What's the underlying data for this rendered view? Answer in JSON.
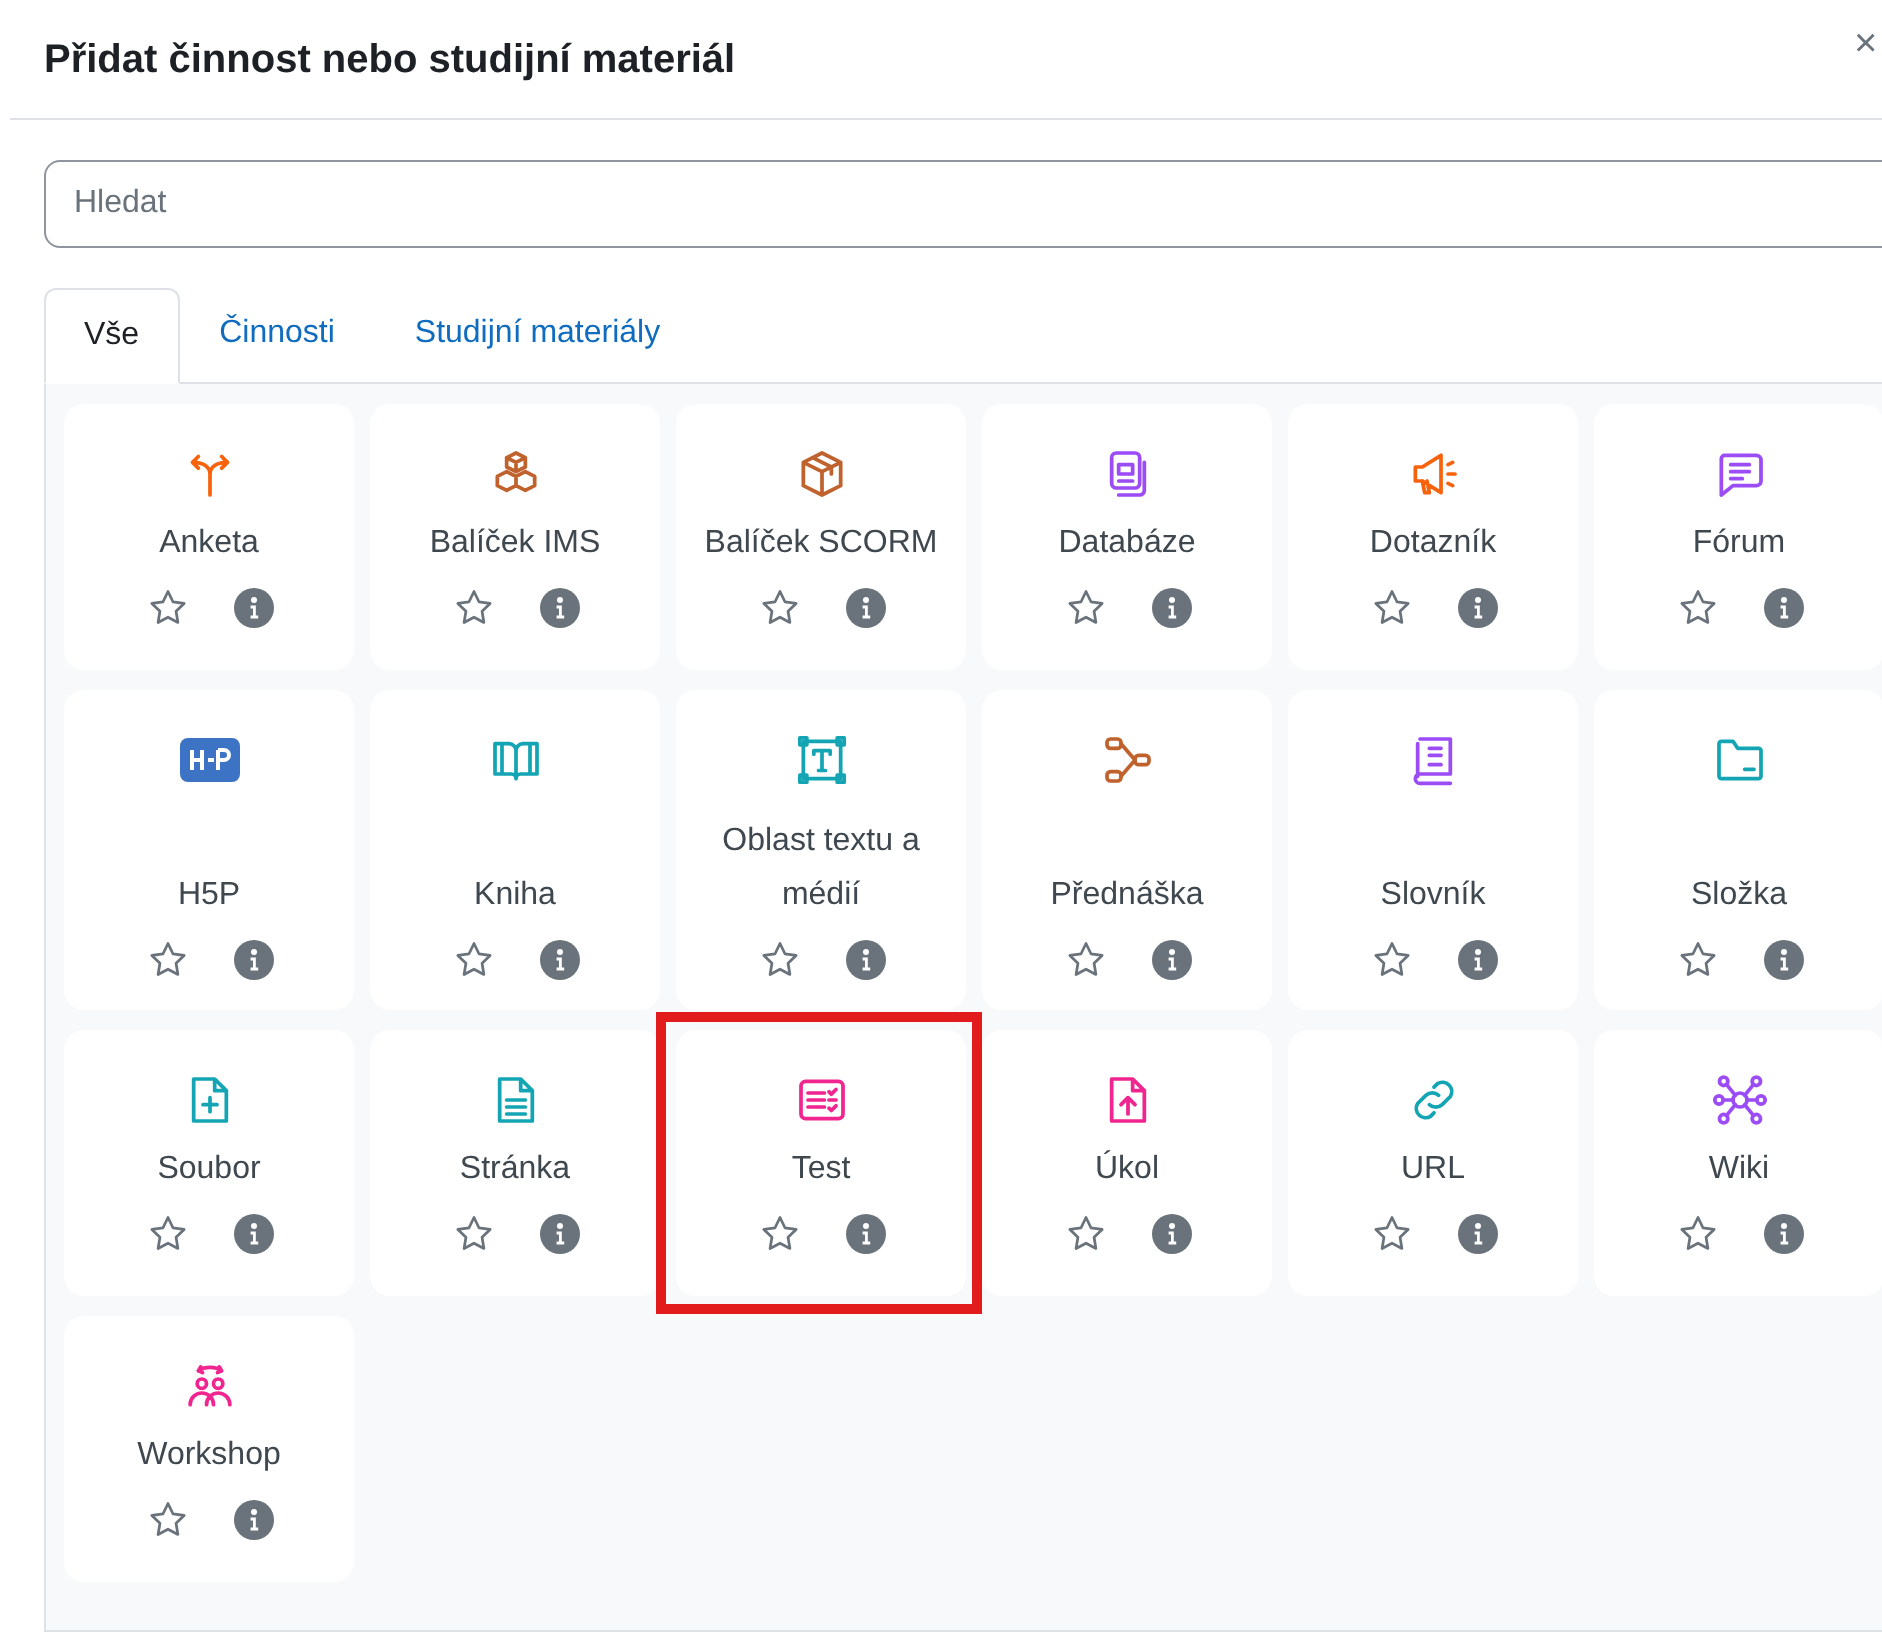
{
  "dialog": {
    "title": "Přidat činnost nebo studijní materiál",
    "close": "×"
  },
  "search": {
    "placeholder": "Hledat"
  },
  "tabs": [
    {
      "label": "Vše",
      "selected": true
    },
    {
      "label": "Činnosti",
      "selected": false
    },
    {
      "label": "Studijní materiály",
      "selected": false
    }
  ],
  "items": [
    {
      "label": "Anketa",
      "color": "#f7630c",
      "starred": false,
      "highlighted": false
    },
    {
      "label": "Balíček IMS",
      "color": "#c0622d",
      "starred": false,
      "highlighted": false
    },
    {
      "label": "Balíček SCORM",
      "color": "#c0622d",
      "starred": false,
      "highlighted": false
    },
    {
      "label": "Databáze",
      "color": "#9b4cf5",
      "starred": false,
      "highlighted": false
    },
    {
      "label": "Dotazník",
      "color": "#f7630c",
      "starred": false,
      "highlighted": false
    },
    {
      "label": "Fórum",
      "color": "#9b4cf5",
      "starred": false,
      "highlighted": false
    },
    {
      "label": "H5P",
      "color": "#3d73c4",
      "starred": false,
      "highlighted": false
    },
    {
      "label": "Kniha",
      "color": "#14a5b5",
      "starred": false,
      "highlighted": false
    },
    {
      "label": "Oblast textu a médií",
      "color": "#14a5b5",
      "starred": false,
      "highlighted": false
    },
    {
      "label": "Přednáška",
      "color": "#c0622d",
      "starred": false,
      "highlighted": false
    },
    {
      "label": "Slovník",
      "color": "#9b4cf5",
      "starred": false,
      "highlighted": false
    },
    {
      "label": "Složka",
      "color": "#14a5b5",
      "starred": false,
      "highlighted": false
    },
    {
      "label": "Soubor",
      "color": "#14a5b5",
      "starred": false,
      "highlighted": false
    },
    {
      "label": "Stránka",
      "color": "#14a5b5",
      "starred": false,
      "highlighted": false
    },
    {
      "label": "Test",
      "color": "#f0258f",
      "starred": false,
      "highlighted": true
    },
    {
      "label": "Úkol",
      "color": "#f0258f",
      "starred": false,
      "highlighted": false
    },
    {
      "label": "URL",
      "color": "#14a5b5",
      "starred": false,
      "highlighted": false
    },
    {
      "label": "Wiki",
      "color": "#9b4cf5",
      "starred": false,
      "highlighted": false
    },
    {
      "label": "Workshop",
      "color": "#f0258f",
      "starred": false,
      "highlighted": false
    }
  ]
}
